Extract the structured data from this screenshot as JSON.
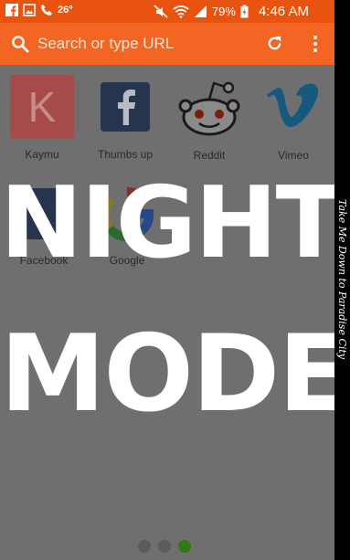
{
  "status_bar": {
    "temperature": "26°",
    "battery": "79%",
    "time": "4:46 AM",
    "icons": [
      "facebook-icon",
      "image-icon",
      "phone-icon",
      "mute-icon",
      "wifi-icon",
      "signal-icon",
      "battery-icon"
    ]
  },
  "toolbar": {
    "search_placeholder": "Search or type URL",
    "accent_color": "#f26522"
  },
  "speed_dial": {
    "row1": [
      {
        "label": "Kaymu",
        "letter": "K"
      },
      {
        "label": "Thumbs up"
      },
      {
        "label": "Reddit"
      },
      {
        "label": "Vimeo"
      }
    ],
    "row2": [
      {
        "label": "Facebook"
      },
      {
        "label": "Google"
      }
    ]
  },
  "overlay": {
    "line1": "NIGHT",
    "line2": "MODE"
  },
  "pager": {
    "count": 3,
    "active_index": 2
  },
  "side_caption": "Take Me Down to Paradise City"
}
